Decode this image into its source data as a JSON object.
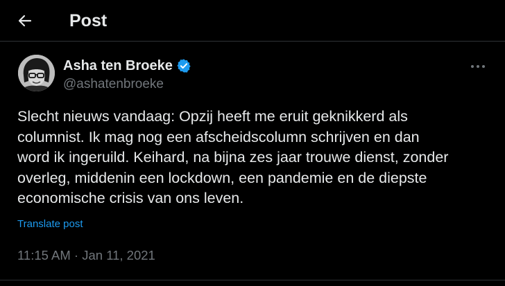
{
  "header": {
    "title": "Post",
    "back_icon": "arrow-left-icon"
  },
  "author": {
    "name": "Asha ten Broeke",
    "handle": "@ashatenbroeke",
    "verified": true,
    "verified_color": "#1d9bf0",
    "avatar": "grayscale photo of a woman with dark bob haircut and glasses"
  },
  "post": {
    "text_lines": [
      "Slecht nieuws vandaag: Opzij heeft me eruit geknikkerd als",
      "columnist. Ik mag nog een afscheidscolumn schrijven en dan",
      "word ik ingeruild. Keihard, na bijna zes jaar trouwe dienst, zonder",
      "overleg, middenin een lockdown, een pandemie en de diepste",
      "economische crisis van ons leven."
    ],
    "translate_label": "Translate post",
    "timestamp": "11:15 AM · Jan 11, 2021"
  },
  "colors": {
    "background": "#000000",
    "text": "#e7e9ea",
    "secondary": "#71767b",
    "link": "#1d9bf0",
    "divider": "#2f3336"
  }
}
